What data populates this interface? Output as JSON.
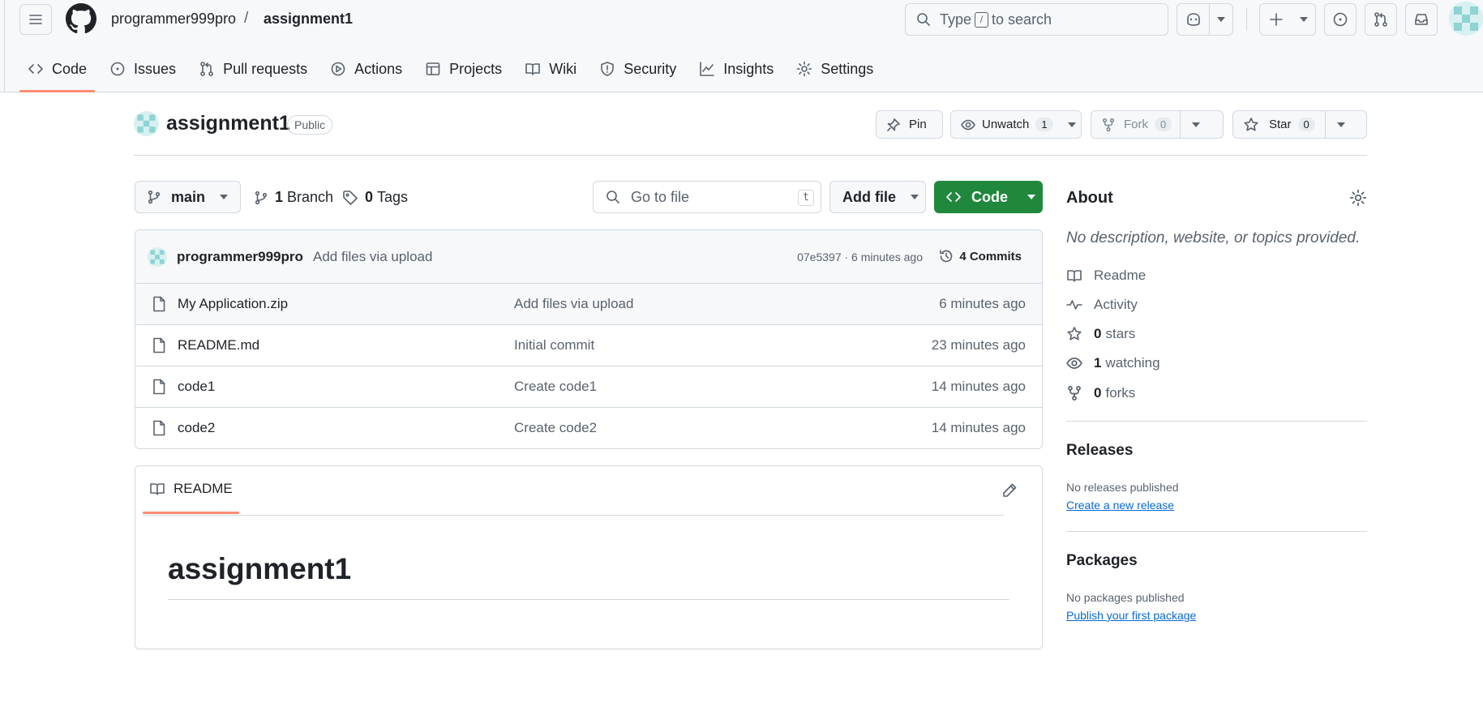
{
  "header": {
    "owner": "programmer999pro",
    "separator": "/",
    "repo": "assignment1",
    "search": {
      "prefix": "Type",
      "key": "/",
      "suffix": "to search"
    },
    "tabs": [
      {
        "label": "Code",
        "icon": "code-icon"
      },
      {
        "label": "Issues",
        "icon": "issue-icon"
      },
      {
        "label": "Pull requests",
        "icon": "pull-request-icon"
      },
      {
        "label": "Actions",
        "icon": "play-icon"
      },
      {
        "label": "Projects",
        "icon": "table-icon"
      },
      {
        "label": "Wiki",
        "icon": "book-icon"
      },
      {
        "label": "Security",
        "icon": "shield-icon"
      },
      {
        "label": "Insights",
        "icon": "graph-icon"
      },
      {
        "label": "Settings",
        "icon": "gear-icon"
      }
    ]
  },
  "repo_header": {
    "name": "assignment1",
    "visibility": "Public",
    "pin_label": "Pin",
    "unwatch_label": "Unwatch",
    "watch_count": "1",
    "fork_label": "Fork",
    "fork_count": "0",
    "star_label": "Star",
    "star_count": "0"
  },
  "file_nav": {
    "branch": "main",
    "branch_count": "1",
    "branch_label": "Branch",
    "tag_count": "0",
    "tag_label": "Tags",
    "goto_placeholder": "Go to file",
    "goto_key": "t",
    "add_file_label": "Add file",
    "code_label": "Code"
  },
  "latest_commit": {
    "author": "programmer999pro",
    "message": "Add files via upload",
    "hash_time": "07e5397 · 6 minutes ago",
    "commits_label": "4 Commits"
  },
  "files": [
    {
      "name": "My Application.zip",
      "message": "Add files via upload",
      "time": "6 minutes ago"
    },
    {
      "name": "README.md",
      "message": "Initial commit",
      "time": "23 minutes ago"
    },
    {
      "name": "code1",
      "message": "Create code1",
      "time": "14 minutes ago"
    },
    {
      "name": "code2",
      "message": "Create code2",
      "time": "14 minutes ago"
    }
  ],
  "readme": {
    "tab_label": "README",
    "heading": "assignment1"
  },
  "about": {
    "title": "About",
    "description": "No description, website, or topics provided.",
    "readme_label": "Readme",
    "activity_label": "Activity",
    "stars_count": "0",
    "stars_label": "stars",
    "watching_count": "1",
    "watching_label": "watching",
    "forks_count": "0",
    "forks_label": "forks"
  },
  "releases": {
    "title": "Releases",
    "empty": "No releases published",
    "link": "Create a new release"
  },
  "packages": {
    "title": "Packages",
    "empty": "No packages published",
    "link": "Publish your first package"
  },
  "colors": {
    "accent_green": "#1f883d",
    "tab_underline": "#fd8c73",
    "link_blue": "#0969da",
    "border": "#d1d9e0"
  }
}
